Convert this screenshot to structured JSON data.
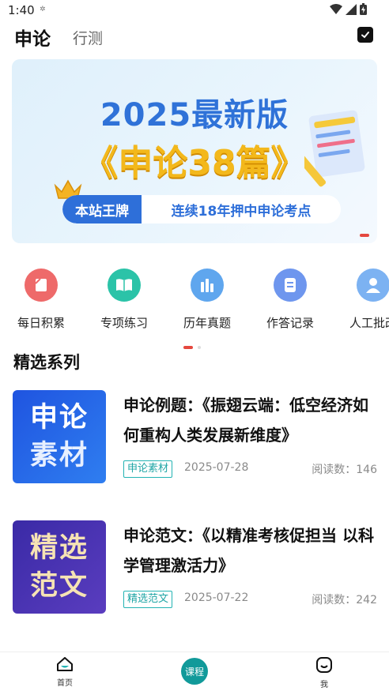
{
  "status_bar": {
    "time": "1:40",
    "notification_icon": "weather-snow-icon"
  },
  "header": {
    "tab_active": "申论",
    "tab_inactive": "行测"
  },
  "banner": {
    "year": "2025最新版",
    "title": "《申论38篇》",
    "ribbon_left": "本站王牌",
    "ribbon_right": "连续18年押中申论考点",
    "accent_color": "#2f72d8"
  },
  "menu": [
    {
      "label": "每日积累",
      "icon": "daily-note-icon",
      "color": "#ee6a6a"
    },
    {
      "label": "专项练习",
      "icon": "book-icon",
      "color": "#2bc3a8"
    },
    {
      "label": "历年真题",
      "icon": "bars-icon",
      "color": "#5fa6ee"
    },
    {
      "label": "作答记录",
      "icon": "record-icon",
      "color": "#6e96ee"
    },
    {
      "label": "人工批改",
      "icon": "person-icon",
      "color": "#7cb2f2"
    }
  ],
  "section": {
    "title": "精选系列"
  },
  "articles": [
    {
      "thumb_line1": "申论",
      "thumb_line2": "素材",
      "title": "申论例题：《振翅云端：低空经济如何重构人类发展新维度》",
      "tag": "申论素材",
      "date": "2025-07-28",
      "reads": "阅读数：146"
    },
    {
      "thumb_line1": "精选",
      "thumb_line2": "范文",
      "title": "申论范文：《以精准考核促担当 以科学管理激活力》",
      "tag": "精选范文",
      "date": "2025-07-22",
      "reads": "阅读数：242"
    }
  ],
  "bottom_nav": {
    "home": "首页",
    "course": "课程",
    "me": "我"
  }
}
